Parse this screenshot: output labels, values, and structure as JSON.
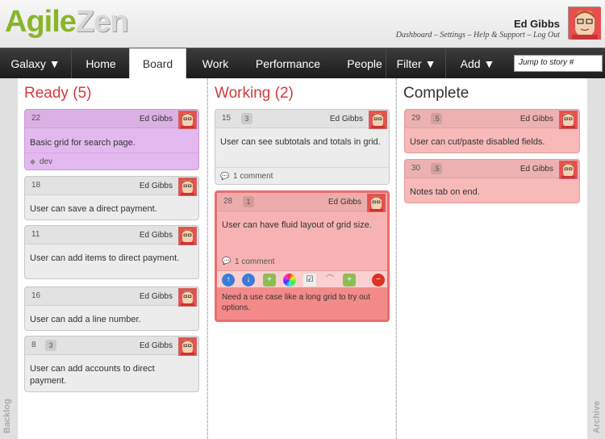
{
  "app": {
    "logo_part1": "Agile",
    "logo_part2": "Zen",
    "user_name": "Ed Gibbs",
    "links": {
      "dashboard": "Dashboard",
      "settings": "Settings",
      "help": "Help & Support",
      "logout": "Log Out",
      "sep": " – "
    }
  },
  "nav": {
    "galaxy": "Galaxy ▼",
    "home": "Home",
    "board": "Board",
    "work": "Work",
    "performance": "Performance",
    "people": "People",
    "filter": "Filter ▼",
    "add": "Add ▼",
    "jump_placeholder": "Jump to story #"
  },
  "sides": {
    "backlog": "Backlog",
    "archive": "Archive"
  },
  "colors": {
    "purple_card": "#e3b8ef",
    "grey_card": "#ececec",
    "pink_card": "#f8b9b9",
    "red_card": "#f28a8a",
    "ready_title": "#d33a3a",
    "complete_title": "#333333"
  },
  "columns": [
    {
      "title": "Ready (5)",
      "cards": [
        {
          "num": "22",
          "badge": "",
          "owner": "Ed Gibbs",
          "desc": "Basic grid for search page.",
          "foot": "dev"
        },
        {
          "num": "18",
          "badge": "",
          "owner": "Ed Gibbs",
          "desc": "User can save a direct payment.",
          "foot": ""
        },
        {
          "num": "11",
          "badge": "",
          "owner": "Ed Gibbs",
          "desc": "User can add items to direct payment.",
          "foot": ""
        },
        {
          "num": "16",
          "badge": "",
          "owner": "Ed Gibbs",
          "desc": "User can add a line number.",
          "foot": ""
        },
        {
          "num": "8",
          "badge": "3",
          "owner": "Ed Gibbs",
          "desc": "User can add accounts to direct payment.",
          "foot": ""
        }
      ]
    },
    {
      "title": "Working (2)",
      "cards": [
        {
          "num": "15",
          "badge": "3",
          "owner": "Ed Gibbs",
          "desc": "User can see subtotals and totals in grid.",
          "foot": "1 comment"
        },
        {
          "num": "28",
          "badge": "1",
          "owner": "Ed Gibbs",
          "desc": "User can have fluid layout of grid size.",
          "foot": "1 comment",
          "blocked": "Need a use case like a long grid to try out options."
        }
      ]
    },
    {
      "title": "Complete",
      "cards": [
        {
          "num": "29",
          "badge": ".5",
          "owner": "Ed Gibbs",
          "desc": "User can cut/paste disabled fields.",
          "foot": ""
        },
        {
          "num": "30",
          "badge": ".5",
          "owner": "Ed Gibbs",
          "desc": "Notes tab on end.",
          "foot": ""
        }
      ]
    }
  ]
}
